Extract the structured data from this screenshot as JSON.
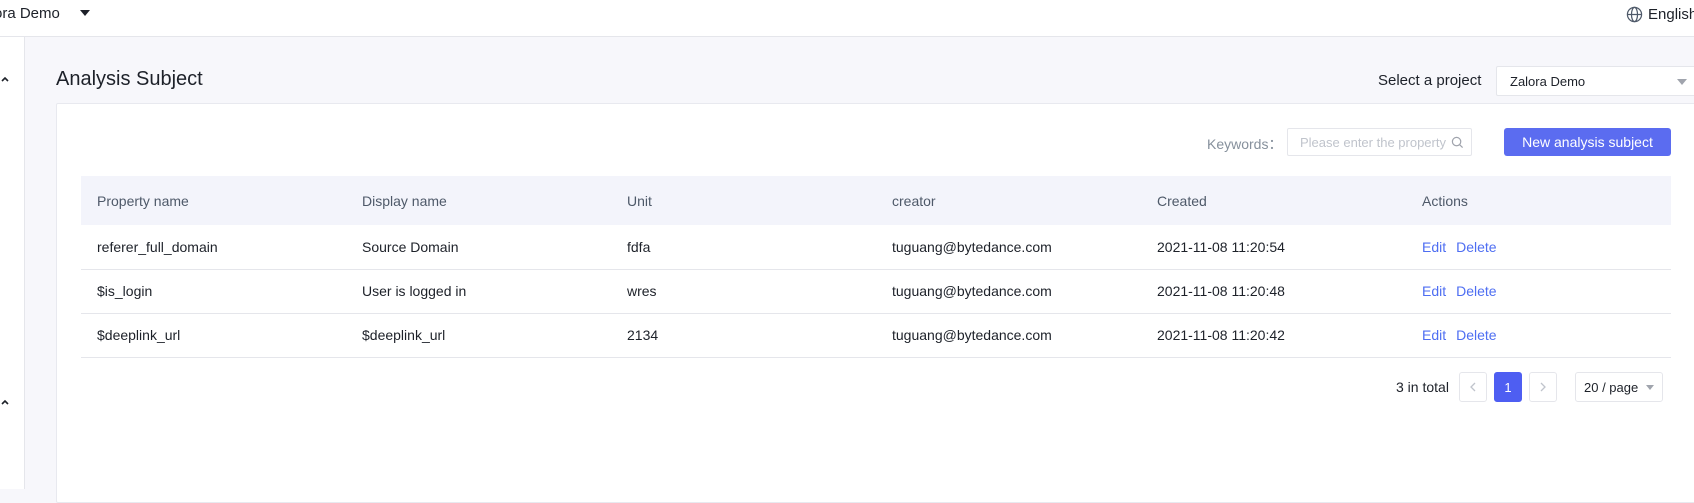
{
  "header": {
    "project_name": "ora Demo",
    "language": "English"
  },
  "page": {
    "title": "Analysis Subject",
    "select_project_label": "Select a project",
    "selected_project": "Zalora Demo"
  },
  "toolbar": {
    "keywords_label": "Keywords：",
    "search_placeholder": "Please enter the property",
    "new_button": "New analysis subject"
  },
  "table": {
    "columns": [
      "Property name",
      "Display name",
      "Unit",
      "creator",
      "Created",
      "Actions"
    ],
    "rows": [
      {
        "property_name": "referer_full_domain",
        "display_name": "Source Domain",
        "unit": "fdfa",
        "creator": "tuguang@bytedance.com",
        "created": "2021-11-08 11:20:54"
      },
      {
        "property_name": "$is_login",
        "display_name": "User is logged in",
        "unit": "wres",
        "creator": "tuguang@bytedance.com",
        "created": "2021-11-08 11:20:48"
      },
      {
        "property_name": "$deeplink_url",
        "display_name": "$deeplink_url",
        "unit": "2134",
        "creator": "tuguang@bytedance.com",
        "created": "2021-11-08 11:20:42"
      }
    ],
    "actions": {
      "edit": "Edit",
      "delete": "Delete"
    }
  },
  "pagination": {
    "total": "3 in total",
    "current_page": "1",
    "page_size": "20 / page"
  },
  "colors": {
    "primary": "#5b6cf0",
    "link": "#4e6ef2"
  }
}
